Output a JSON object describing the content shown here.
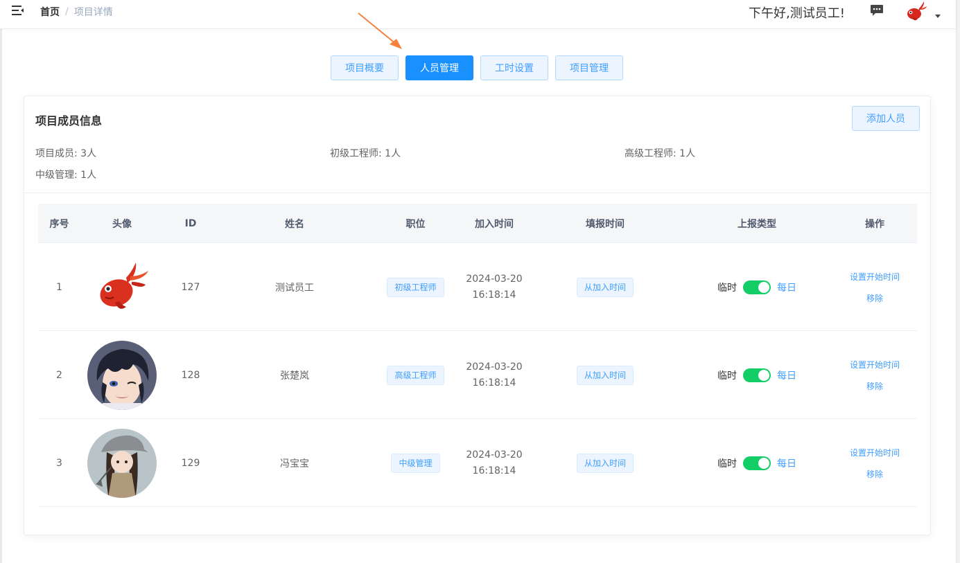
{
  "header": {
    "breadcrumb": {
      "home": "首页",
      "separator": "/",
      "current": "项目详情"
    },
    "greeting": "下午好,测试员工!",
    "icons": {
      "menu": "hamburger-icon",
      "message": "message-icon",
      "avatar": "koi-fish-avatar",
      "dropdown": "caret-down-icon"
    }
  },
  "tabs": [
    {
      "label": "项目概要",
      "active": false
    },
    {
      "label": "人员管理",
      "active": true
    },
    {
      "label": "工时设置",
      "active": false
    },
    {
      "label": "项目管理",
      "active": false
    }
  ],
  "card": {
    "title": "项目成员信息",
    "add_button": "添加人员",
    "stats": [
      {
        "text": "项目成员:  3人"
      },
      {
        "text": "初级工程师:  1人"
      },
      {
        "text": "高级工程师:  1人"
      },
      {
        "text": "中级管理:  1人"
      }
    ]
  },
  "table": {
    "headers": [
      "序号",
      "头像",
      "ID",
      "姓名",
      "职位",
      "加入时间",
      "填报时间",
      "上报类型",
      "操作"
    ],
    "rows": [
      {
        "index": "1",
        "avatar": "koi-fish-avatar",
        "id": "127",
        "name": "测试员工",
        "position": "初级工程师",
        "join_date": "2024-03-20",
        "join_time": "16:18:14",
        "report_time": "从加入时间",
        "type_off": "临时",
        "type_on": "每日",
        "switch_on": true,
        "op_set": "设置开始时间",
        "op_remove": "移除"
      },
      {
        "index": "2",
        "avatar": "anime-boy-avatar",
        "id": "128",
        "name": "张楚岚",
        "position": "高级工程师",
        "join_date": "2024-03-20",
        "join_time": "16:18:14",
        "report_time": "从加入时间",
        "type_off": "临时",
        "type_on": "每日",
        "switch_on": true,
        "op_set": "设置开始时间",
        "op_remove": "移除"
      },
      {
        "index": "3",
        "avatar": "anime-girl-avatar",
        "id": "129",
        "name": "冯宝宝",
        "position": "中级管理",
        "join_date": "2024-03-20",
        "join_time": "16:18:14",
        "report_time": "从加入时间",
        "type_off": "临时",
        "type_on": "每日",
        "switch_on": true,
        "op_set": "设置开始时间",
        "op_remove": "移除"
      }
    ]
  },
  "colors": {
    "primary": "#1890ff",
    "link": "#409eff",
    "switch_on": "#13ce66",
    "arrow": "#f5813d"
  }
}
